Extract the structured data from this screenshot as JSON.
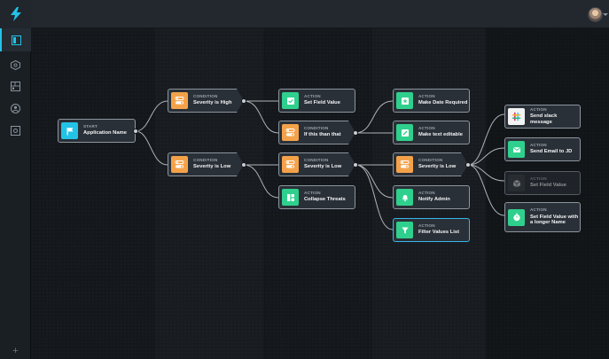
{
  "sidebar": {
    "items": [
      {
        "name": "workflows",
        "active": true
      },
      {
        "name": "integrations",
        "active": false
      },
      {
        "name": "dashboards",
        "active": false
      },
      {
        "name": "users",
        "active": false
      },
      {
        "name": "settings",
        "active": false
      }
    ],
    "plus": "+"
  },
  "nodes": {
    "start": {
      "kind": "START",
      "label": "Application Name"
    },
    "cond_high": {
      "kind": "CONDITION",
      "label": "Severity is High"
    },
    "cond_low_1": {
      "kind": "CONDITION",
      "label": "Severity is Low"
    },
    "act_set_field": {
      "kind": "ACTION",
      "label": "Set Field Value"
    },
    "cond_this": {
      "kind": "CONDITION",
      "label": "If this than that"
    },
    "cond_low_2": {
      "kind": "CONDITION",
      "label": "Severity is Low"
    },
    "act_collapse": {
      "kind": "ACTION",
      "label": "Collapse Threats"
    },
    "act_date": {
      "kind": "ACTION",
      "label": "Make Date Required"
    },
    "act_text": {
      "kind": "ACTION",
      "label": "Make text editable"
    },
    "cond_low_3": {
      "kind": "CONDITION",
      "label": "Severity is Low"
    },
    "act_notify": {
      "kind": "ACTION",
      "label": "Notify Admin"
    },
    "act_filter": {
      "kind": "ACTION",
      "label": "Filter Values List"
    },
    "act_slack": {
      "kind": "ACTION",
      "label": "Send slack message"
    },
    "act_email": {
      "kind": "ACTION",
      "label": "Send Email to JD"
    },
    "act_set_field_2": {
      "kind": "ACTION",
      "label": "Set Field Value"
    },
    "act_set_field_long": {
      "kind": "ACTION",
      "label": "Set Field Value with a longer Name"
    }
  },
  "colors": {
    "action": "#2fd08d",
    "condition": "#f4a24a",
    "start": "#22c3e6",
    "selected_border": "#38b6e8"
  }
}
